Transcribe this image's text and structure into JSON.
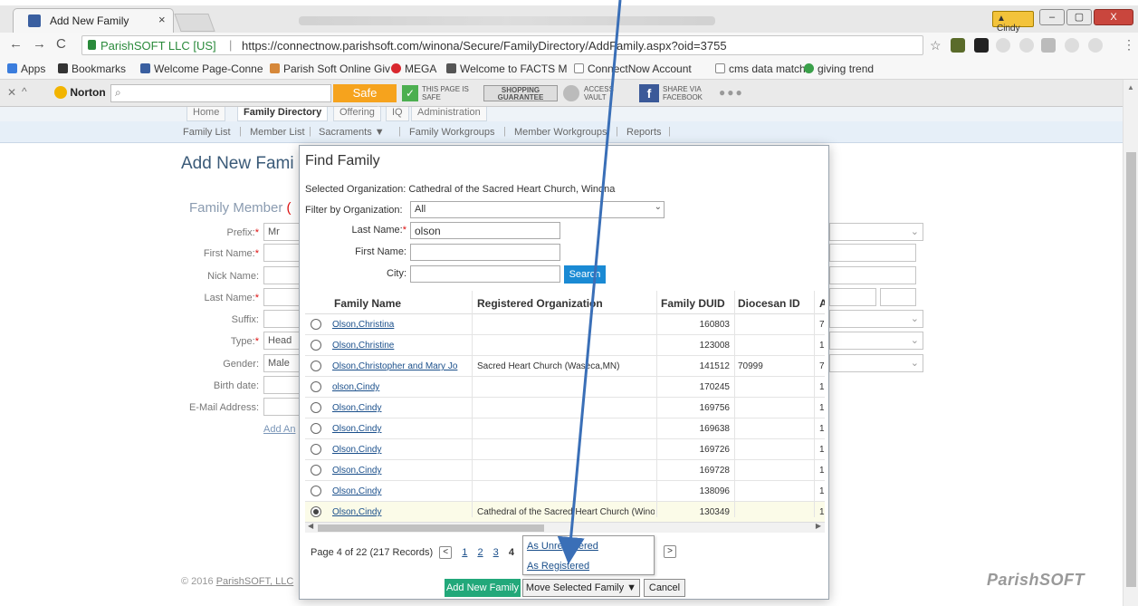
{
  "browser": {
    "tab_title": "Add New Family",
    "tab_close": "×",
    "profile_chip": "Cindy",
    "window_controls": {
      "minimize": "–",
      "maximize": "▢",
      "close": "X"
    },
    "site_label": "ParishSOFT LLC [US]",
    "url_sep": "|",
    "url": "https://connectnow.parishsoft.com/winona/Secure/FamilyDirectory/AddFamily.aspx?oid=3755",
    "bookmarks": [
      "Apps",
      "Bookmarks",
      "Welcome Page-Conne",
      "Parish Soft Online Giv",
      "MEGA",
      "Welcome to FACTS M",
      "ConnectNow Account",
      "cms data match",
      "giving trend"
    ]
  },
  "norton": {
    "logo": "Norton",
    "safe_search": "Safe Search",
    "page_safe": "THIS PAGE IS SAFE",
    "shopping": "SHOPPING GUARANTEE",
    "access_vault": "ACCESS VAULT",
    "share_facebook": "SHARE VIA FACEBOOK"
  },
  "nav": {
    "tabs": [
      "Home",
      "Family Directory",
      "Offering",
      "IQ",
      "Administration"
    ],
    "subnav": [
      "Family List",
      "Member List",
      "Sacraments ▼",
      "Family Workgroups",
      "Member Workgroups",
      "Reports"
    ]
  },
  "page": {
    "title": "Add New Fami",
    "section": "Family Member",
    "section_tail": "(",
    "labels": [
      "Prefix:",
      "First Name:",
      "Nick Name:",
      "Last Name:",
      "Suffix:",
      "Type:",
      "Gender:",
      "Birth date:",
      "E-Mail Address:"
    ],
    "prefix_value": "Mr",
    "type_value": "Head",
    "gender_value": "Male",
    "add_another": "Add An",
    "footer": "© 2016",
    "footer_link": "ParishSOFT, LLC",
    "logo": "ParishSOFT"
  },
  "modal": {
    "title": "Find Family",
    "selected_org": "Selected Organization: Cathedral of the Sacred Heart Church, Winona",
    "filter_label": "Filter by Organization:",
    "filter_value": "All",
    "last_name_label": "Last Name:",
    "last_name_value": "olson",
    "first_name_label": "First Name:",
    "city_label": "City:",
    "search_button": "Search",
    "columns": [
      "Family Name",
      "Registered Organization",
      "Family DUID",
      "Diocesan ID",
      "A"
    ],
    "rows": [
      {
        "name": "Olson,Christina",
        "org": "",
        "duid": "160803",
        "dioc": "",
        "a": "7",
        "selected": false
      },
      {
        "name": "Olson,Christine",
        "org": "",
        "duid": "123008",
        "dioc": "",
        "a": "1",
        "selected": false
      },
      {
        "name": "Olson,Christopher and Mary Jo",
        "org": "Sacred Heart Church (Waseca,MN)",
        "duid": "141512",
        "dioc": "70999",
        "a": "7",
        "selected": false
      },
      {
        "name": "olson,Cindy",
        "org": "",
        "duid": "170245",
        "dioc": "",
        "a": "1",
        "selected": false
      },
      {
        "name": "Olson,Cindy",
        "org": "",
        "duid": "169756",
        "dioc": "",
        "a": "1",
        "selected": false
      },
      {
        "name": "Olson,Cindy",
        "org": "",
        "duid": "169638",
        "dioc": "",
        "a": "1",
        "selected": false
      },
      {
        "name": "Olson,Cindy",
        "org": "",
        "duid": "169726",
        "dioc": "",
        "a": "1",
        "selected": false
      },
      {
        "name": "Olson,Cindy",
        "org": "",
        "duid": "169728",
        "dioc": "",
        "a": "1",
        "selected": false
      },
      {
        "name": "Olson,Cindy",
        "org": "",
        "duid": "138096",
        "dioc": "",
        "a": "1",
        "selected": false
      },
      {
        "name": "Olson,Cindy",
        "org": "Cathedral of the Sacred Heart Church (Winor",
        "duid": "130349",
        "dioc": "",
        "a": "1",
        "selected": true
      }
    ],
    "pager_text": "Page 4 of 22 (217 Records)",
    "pager_links": [
      "1",
      "2",
      "3"
    ],
    "pager_current": "4",
    "pager_prev": "<",
    "pager_next": ">",
    "move_menu": [
      "As Unregistered",
      "As Registered"
    ],
    "add_family_button": "Add New Family",
    "move_button": "Move Selected Family ▼",
    "cancel_button": "Cancel"
  },
  "colors": {
    "accent_blue": "#1a8ad4",
    "add_green": "#22a87a",
    "annotation_arrow": "#3a6fb7"
  }
}
